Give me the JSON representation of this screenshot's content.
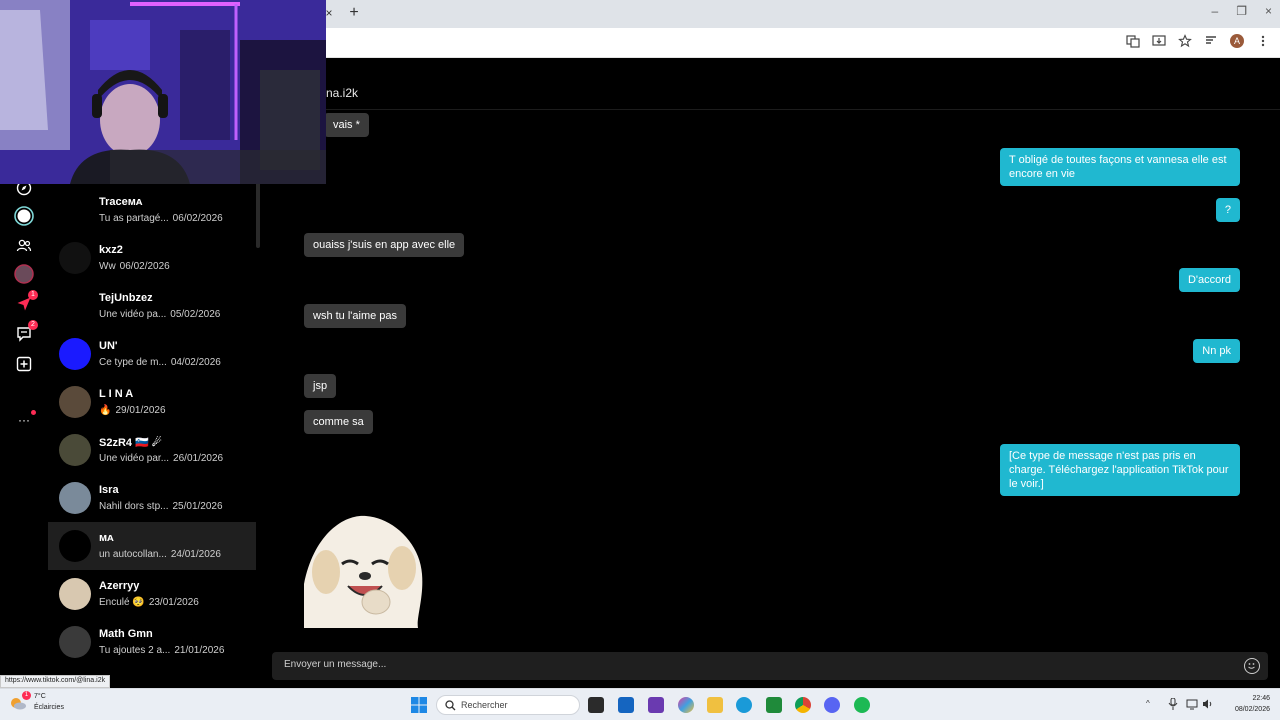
{
  "browser": {
    "tab_close": "×",
    "tab_new": "+",
    "window_controls": [
      "–",
      "❐",
      "×"
    ],
    "profile_initial": "A"
  },
  "sidebar": {
    "inbox_badge": "1",
    "messages_badge": "2",
    "more_label": "···"
  },
  "conversations": [
    {
      "name": "Traceᴍᴀ",
      "preview": "Tu as partagé...",
      "date": "06/02/2026",
      "avatar_color": "#000000"
    },
    {
      "name": "kxz2",
      "preview": "Ww",
      "date": "06/02/2026",
      "avatar_color": "#111111"
    },
    {
      "name": "TejUnbzez",
      "preview": "Une vidéo pa...",
      "date": "05/02/2026",
      "avatar_color": "#000000"
    },
    {
      "name": "UN'",
      "preview": "Ce type de m...",
      "date": "04/02/2026",
      "avatar_color": "#1a1aff"
    },
    {
      "name": "L I N A",
      "preview": "🔥",
      "date": "29/01/2026",
      "avatar_color": "#5a4a3a"
    },
    {
      "name": "S2zR4 🇸🇮 ☄",
      "preview": "Une vidéo par...",
      "date": "26/01/2026",
      "avatar_color": "#4a4a38"
    },
    {
      "name": "Isra",
      "preview": "Nahil dors stp...",
      "date": "25/01/2026",
      "avatar_color": "#7a8a9a"
    },
    {
      "name": "ᴍᴀ",
      "preview": "un autocollan...",
      "date": "24/01/2026",
      "avatar_color": "#000000",
      "active": true
    },
    {
      "name": "Azerryy",
      "preview": "Enculé 🥺",
      "date": "23/01/2026",
      "avatar_color": "#d8c8b0"
    },
    {
      "name": "Math Gmn",
      "preview": "Tu ajoutes 2 a...",
      "date": "21/01/2026",
      "avatar_color": "#3a3a3a"
    }
  ],
  "chat": {
    "header_title": "na.i2k",
    "messages": [
      {
        "dir": "in",
        "text": "vais *"
      },
      {
        "dir": "out",
        "text": "T obligé de toutes façons et vannesa elle est encore en vie"
      },
      {
        "dir": "out",
        "text": "?"
      },
      {
        "dir": "in",
        "text": "ouaiss j'suis en app avec elle"
      },
      {
        "dir": "out",
        "text": "D'accord"
      },
      {
        "dir": "in",
        "text": "wsh tu l'aime pas"
      },
      {
        "dir": "out",
        "text": "Nn pk"
      },
      {
        "dir": "in",
        "text": "jsp"
      },
      {
        "dir": "in",
        "text": "comme sa"
      },
      {
        "dir": "out",
        "text": "[Ce type de message n'est pas pris en charge. Téléchargez l'application TikTok pour le voir.]"
      }
    ],
    "composer_placeholder": "Envoyer un message..."
  },
  "status_url": "https://www.tiktok.com/@lina.i2k",
  "taskbar": {
    "weather_temp": "7°C",
    "weather_desc": "Éclaircies",
    "weather_badge": "1",
    "search_label": "Rechercher",
    "time": "22:46",
    "date": "08/02/2026"
  },
  "colors": {
    "accent": "#20b8d0",
    "incoming": "#3a3a3a",
    "badge": "#fe2c55"
  }
}
